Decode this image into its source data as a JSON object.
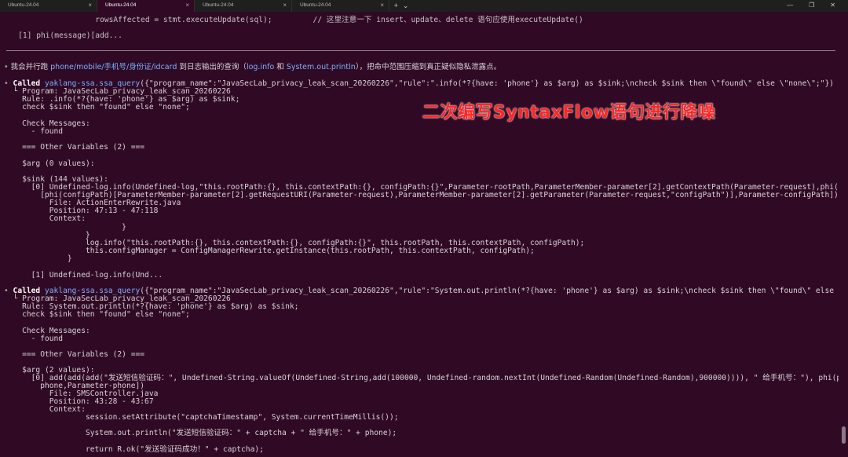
{
  "tabs": [
    {
      "label": "Ubuntu-24.04",
      "active": false
    },
    {
      "label": "Ubuntu-24.04",
      "active": true
    },
    {
      "label": "Ubuntu-24.04",
      "active": false
    },
    {
      "label": "Ubuntu-24.04",
      "active": false
    }
  ],
  "icons": {
    "close": "close-icon",
    "new_tab": "plus-icon",
    "dropdown": "chevron-down-icon",
    "minimize": "minimize-icon",
    "maximize": "maximize-icon",
    "window_close": "close-icon"
  },
  "glyphs": {
    "close": "×",
    "plus": "+",
    "chevron": "⌄",
    "minimize": "—",
    "maximize": "❐",
    "window_close": "✕"
  },
  "colors": {
    "terminal_bg": "#300a24",
    "link_blue": "#7ab0ff",
    "overlay_red": "#ff2525"
  },
  "lines": {
    "l1": "                     rowsAffected = stmt.executeUpdate(sql);         // 这里注意一下 insert、update、delete 语句应使用executeUpdate()",
    "l2": "    [1] phi(message)[add...",
    "msg_bullet": "•",
    "msg_a": " 我会并行跑 ",
    "msg_b": "phone/mobile/手机号/身份证/idcard",
    "msg_c": " 到日志输出的查询（",
    "msg_d": "log.info",
    "msg_e": " 和 ",
    "msg_f": "System.out.println",
    "msg_g": "），把命中范围压缩到真正疑似隐私泄露点。",
    "c1_bullet": "•",
    "c1_called": " Called ",
    "c1_fn": "yaklang-ssa.ssa_query",
    "c1_args": "({\"program_name\":\"JavaSecLab_privacy_leak_scan_20260226\",\"rule\":\".info(*?{have: 'phone'} as $arg) as $sink;\\ncheck $sink then \\\"found\\\" else \\\"none\\\";\"})",
    "c1_l1": "  └ Program: JavaSecLab_privacy_leak_scan_20260226",
    "c1_l2": "    Rule: .info(*?{have: 'phone'} as $arg) as $sink;",
    "c1_l3": "    check $sink then \"found\" else \"none\";",
    "c1_l4": "    Check Messages:",
    "c1_l5": "      - found",
    "c1_l6": "    === Other Variables (2) ===",
    "c1_l7": "    $arg (0 values):",
    "c1_l8": "    $sink (144 values):",
    "c1_l9": "      [0] Undefined-log.info(Undefined-log,\"this.rootPath:{}, this.contextPath:{}, configPath:{}\",Parameter-rootPath,ParameterMember-parameter[2].getContextPath(Parameter-request),phi(configPath)",
    "c1_l10": "        [phi(configPath)[ParameterMember-parameter[2].getRequestURI(Parameter-request),ParameterMember-parameter[2].getParameter(Parameter-request,\"configPath\")],Parameter-configPath])",
    "c1_l11": "          File: ActionEnterRewrite.java",
    "c1_l12": "          Position: 47:13 - 47:118",
    "c1_l13": "          Context:",
    "c1_l14": "                          }",
    "c1_l15": "                  }",
    "c1_l16": "                  log.info(\"this.rootPath:{}, this.contextPath:{}, configPath:{}\", this.rootPath, this.contextPath, configPath);",
    "c1_l17": "                  this.configManager = ConfigManagerRewrite.getInstance(this.rootPath, this.contextPath, configPath);",
    "c1_l18": "              }",
    "c1_l19": "      [1] Undefined-log.info(Und...",
    "c2_bullet": "•",
    "c2_called": " Called ",
    "c2_fn": "yaklang-ssa.ssa_query",
    "c2_args": "({\"program_name\":\"JavaSecLab_privacy_leak_scan_20260226\",\"rule\":\"System.out.println(*?{have: 'phone'} as $arg) as $sink;\\ncheck $sink then \\\"found\\\" else \\\"none\\\";\"})",
    "c2_l1": "  └ Program: JavaSecLab_privacy_leak_scan_20260226",
    "c2_l2": "    Rule: System.out.println(*?{have: 'phone'} as $arg) as $sink;",
    "c2_l3": "    check $sink then \"found\" else \"none\";",
    "c2_l4": "    Check Messages:",
    "c2_l5": "      - found",
    "c2_l6": "    === Other Variables (2) ===",
    "c2_l7": "    $arg (2 values):",
    "c2_l8": "      [0] add(add(add(\"发送短信验证码：\", Undefined-String.valueOf(Undefined-String,add(100000, Undefined-random.nextInt(Undefined-Random(Undefined-Random),900000)))), \" 给手机号：\"), phi(phone)[Undefined-",
    "c2_l9": "        phone,Parameter-phone])",
    "c2_l10": "          File: SMSController.java",
    "c2_l11": "          Position: 43:28 - 43:67",
    "c2_l12": "          Context:",
    "c2_l13": "                  session.setAttribute(\"captchaTimestamp\", System.currentTimeMillis());",
    "c2_l14": "                  System.out.println(\"发送短信验证码：\" + captcha + \" 给手机号：\" + phone);",
    "c2_l15": "                  return R.ok(\"发送验证码成功！\" + captcha);"
  },
  "overlay": "二次编写SyntaxFlow语句进行降噪"
}
